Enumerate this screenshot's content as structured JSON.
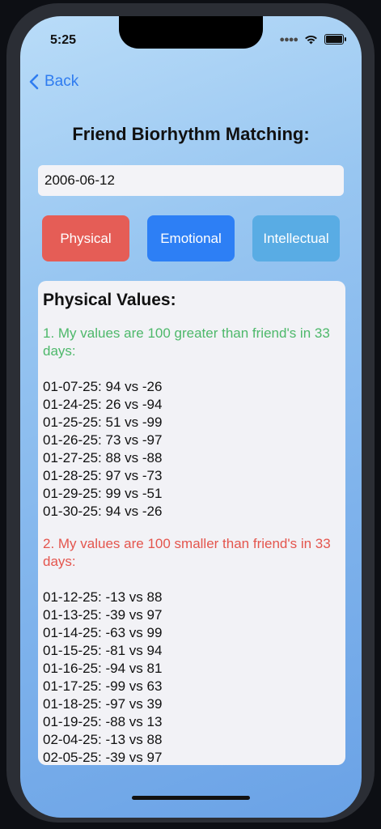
{
  "status": {
    "time": "5:25"
  },
  "nav": {
    "back_label": "Back"
  },
  "page": {
    "title": "Friend Biorhythm Matching:"
  },
  "date_input": {
    "value": "2006-06-12"
  },
  "tabs": {
    "physical": "Physical",
    "emotional": "Emotional",
    "intellectual": "Intellectual"
  },
  "colors": {
    "physical": "#e55d56",
    "emotional": "#2d7ff5",
    "intellectual": "#59ace4",
    "greater_text": "#4db86a",
    "smaller_text": "#e4554d",
    "back_link": "#2f7cf0"
  },
  "results": {
    "title": "Physical Values:",
    "greater": {
      "heading": "1. My values are 100 greater than friend's in 33 days:",
      "rows": [
        "01-07-25: 94 vs -26",
        "01-24-25: 26 vs -94",
        "01-25-25: 51 vs -99",
        "01-26-25: 73 vs -97",
        "01-27-25: 88 vs -88",
        "01-28-25: 97 vs -73",
        "01-29-25: 99 vs -51",
        "01-30-25: 94 vs -26"
      ]
    },
    "smaller": {
      "heading": "2. My values are 100 smaller than friend's in 33 days:",
      "rows": [
        "01-12-25: -13 vs 88",
        "01-13-25: -39 vs 97",
        "01-14-25: -63 vs 99",
        "01-15-25: -81 vs 94",
        "01-16-25: -94 vs 81",
        "01-17-25: -99 vs 63",
        "01-18-25: -97 vs 39",
        "01-19-25: -88 vs 13",
        "02-04-25: -13 vs 88",
        "02-05-25: -39 vs 97"
      ]
    }
  }
}
